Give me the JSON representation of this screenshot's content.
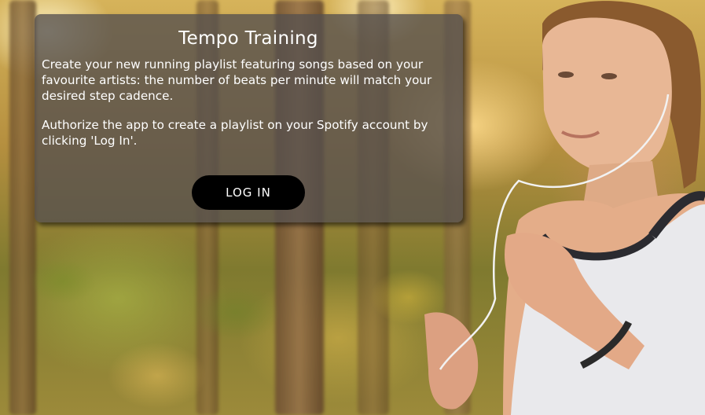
{
  "card": {
    "title": "Tempo Training",
    "description": "Create your new running playlist featuring songs based on your favourite artists: the number of beats per minute will match your desired step cadence.",
    "instructions": "Authorize the app to create a playlist on your Spotify account by clicking 'Log In'.",
    "login_label": "LOG IN"
  },
  "colors": {
    "card_background": "#55504e",
    "button_background": "#000000",
    "text": "#ffffff"
  }
}
